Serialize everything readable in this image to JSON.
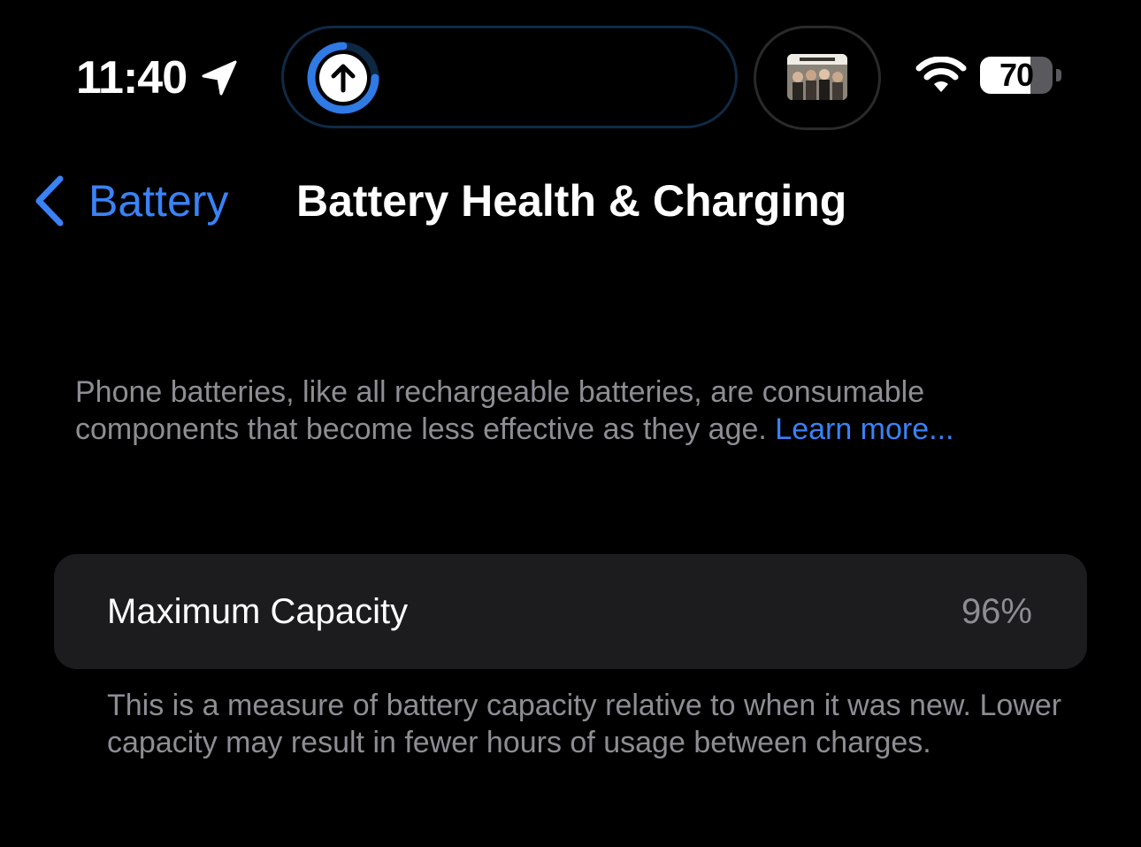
{
  "status_bar": {
    "time": "11:40",
    "battery_level": 70,
    "battery_label": "70",
    "location_icon": "location-arrow-icon",
    "wifi_icon": "wifi-icon",
    "upload_icon": "upload-arrow-icon",
    "colors": {
      "accent": "#3a82f6",
      "battery_empty": "#5a5a5e"
    }
  },
  "nav": {
    "back_label": "Battery",
    "title": "Battery Health & Charging"
  },
  "intro": {
    "text": "Phone batteries, like all rechargeable batteries, are consumable components that become less effective as they age. ",
    "link": "Learn more..."
  },
  "capacity": {
    "label": "Maximum Capacity",
    "value": "96%",
    "footer": "This is a measure of battery capacity relative to when it was new. Lower capacity may result in fewer hours of usage between charges."
  },
  "colors": {
    "background": "#000000",
    "cell_background": "#1c1c1e",
    "secondary_text": "#8d8d93",
    "link": "#3a82f6"
  }
}
